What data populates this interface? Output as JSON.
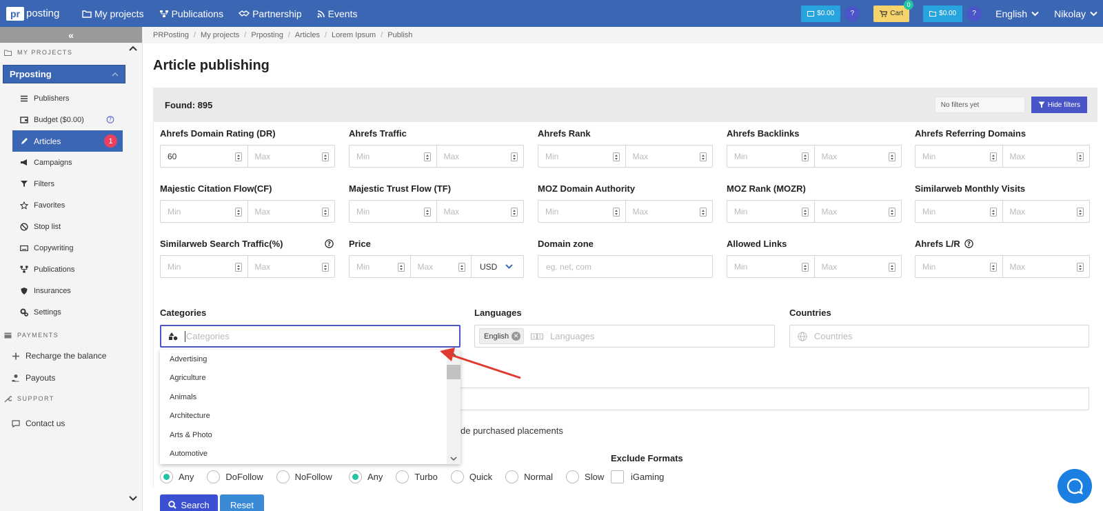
{
  "topbar": {
    "logo_mark": "pr",
    "logo_text": "posting",
    "nav": [
      "My projects",
      "Publications",
      "Partnership",
      "Events"
    ],
    "balance1": "$0.00",
    "cart_label": "Cart",
    "cart_count": "0",
    "balance2": "$0.00",
    "help": "?",
    "language": "English",
    "user": "Nikolay"
  },
  "sidebar": {
    "collapse": "«",
    "my_projects_label": "MY PROJECTS",
    "project": "Prposting",
    "items": [
      {
        "label": "Publishers",
        "icon": "list-icon"
      },
      {
        "label": "Budget ($0.00)",
        "icon": "wallet-icon"
      },
      {
        "label": "Articles",
        "icon": "pencil-icon",
        "badge": "1"
      },
      {
        "label": "Campaigns",
        "icon": "megaphone-icon"
      },
      {
        "label": "Filters",
        "icon": "filter-icon"
      },
      {
        "label": "Favorites",
        "icon": "star-icon"
      },
      {
        "label": "Stop list",
        "icon": "stop-icon"
      },
      {
        "label": "Copywriting",
        "icon": "keyboard-icon"
      },
      {
        "label": "Publications",
        "icon": "network-icon"
      },
      {
        "label": "Insurances",
        "icon": "shield-icon"
      },
      {
        "label": "Settings",
        "icon": "gears-icon"
      }
    ],
    "payments_label": "PAYMENTS",
    "recharge": "Recharge the balance",
    "payouts": "Payouts",
    "support_label": "SUPPORT",
    "contact": "Contact us"
  },
  "breadcrumb": [
    "PRPosting",
    "My projects",
    "Prposting",
    "Articles",
    "Lorem Ipsum",
    "Publish"
  ],
  "page_title": "Article publishing",
  "panel": {
    "found": "Found: 895",
    "no_filters": "No filters yet",
    "hide_filters": "Hide filters"
  },
  "filters": {
    "dr": {
      "label": "Ahrefs Domain Rating (DR)",
      "min": "60",
      "max": "Max"
    },
    "traffic": {
      "label": "Ahrefs Traffic",
      "min": "Min",
      "max": "Max"
    },
    "rank": {
      "label": "Ahrefs Rank",
      "min": "Min",
      "max": "Max"
    },
    "backlinks": {
      "label": "Ahrefs Backlinks",
      "min": "Min",
      "max": "Max"
    },
    "refdomains": {
      "label": "Ahrefs Referring Domains",
      "min": "Min",
      "max": "Max"
    },
    "cf": {
      "label": "Majestic Citation Flow(CF)",
      "min": "Min",
      "max": "Max"
    },
    "tf": {
      "label": "Majestic Trust Flow (TF)",
      "min": "Min",
      "max": "Max"
    },
    "moz_da": {
      "label": "MOZ Domain Authority",
      "min": "Min",
      "max": "Max"
    },
    "mozr": {
      "label": "MOZ Rank (MOZR)",
      "min": "Min",
      "max": "Max"
    },
    "sw_visits": {
      "label": "Similarweb Monthly Visits",
      "min": "Min",
      "max": "Max"
    },
    "sw_search": {
      "label": "Similarweb Search Traffic(%)",
      "min": "Min",
      "max": "Max"
    },
    "price": {
      "label": "Price",
      "min": "Min",
      "max": "Max",
      "currency": "USD"
    },
    "zone": {
      "label": "Domain zone",
      "placeholder": "eg. net, com"
    },
    "links": {
      "label": "Allowed Links",
      "min": "Min",
      "max": "Max"
    },
    "lr": {
      "label": "Ahrefs L/R",
      "min": "Min",
      "max": "Max"
    }
  },
  "categories": {
    "label": "Categories",
    "placeholder": "Categories",
    "options": [
      "Advertising",
      "Agriculture",
      "Animals",
      "Architecture",
      "Arts & Photo",
      "Automotive"
    ]
  },
  "languages": {
    "label": "Languages",
    "chip": "English",
    "placeholder": "Languages"
  },
  "countries": {
    "label": "Countries",
    "placeholder": "Countries"
  },
  "partial_checkbox_text": "de purchased placements",
  "link_type": [
    "Any",
    "DoFollow",
    "NoFollow"
  ],
  "speed": [
    "Any",
    "Turbo",
    "Quick",
    "Normal",
    "Slow"
  ],
  "exclude_formats": {
    "label": "Exclude Formats",
    "option": "iGaming"
  },
  "buttons": {
    "search": "Search",
    "reset": "Reset"
  }
}
